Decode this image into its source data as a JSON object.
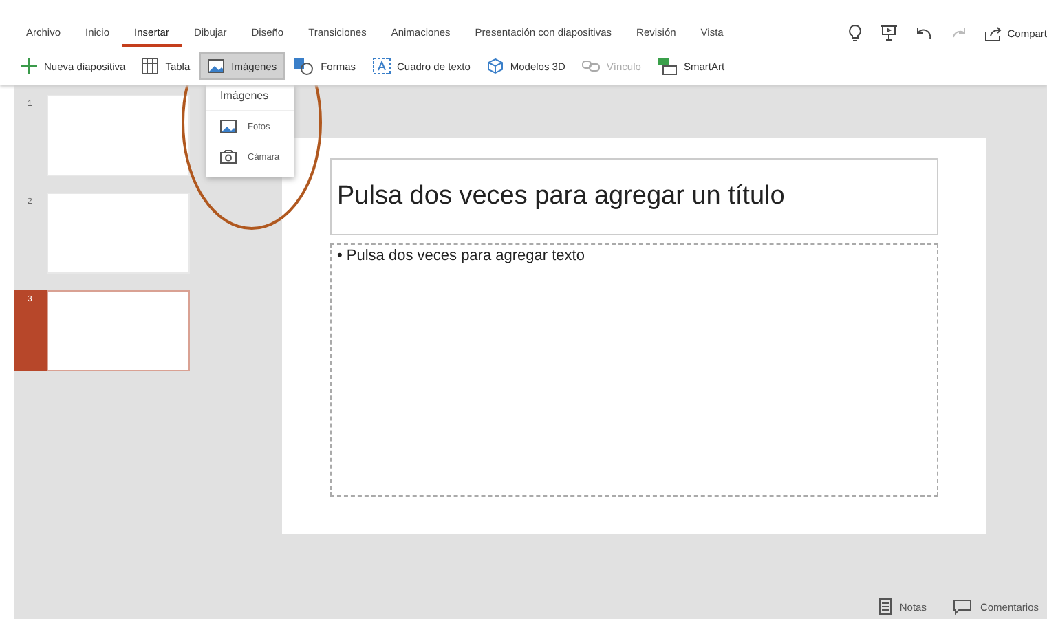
{
  "tabs": [
    {
      "label": "Archivo",
      "selected": false
    },
    {
      "label": "Inicio",
      "selected": false
    },
    {
      "label": "Insertar",
      "selected": true
    },
    {
      "label": "Dibujar",
      "selected": false
    },
    {
      "label": "Diseño",
      "selected": false
    },
    {
      "label": "Transiciones",
      "selected": false
    },
    {
      "label": "Animaciones",
      "selected": false
    },
    {
      "label": "Presentación con diapositivas",
      "selected": false
    },
    {
      "label": "Revisión",
      "selected": false
    },
    {
      "label": "Vista",
      "selected": false
    }
  ],
  "share_button": {
    "label": "Compart"
  },
  "toolbar": [
    {
      "kind": "plus",
      "label": "Nueva diapositiva",
      "selected": false,
      "disabled": false
    },
    {
      "kind": "table",
      "label": "Tabla",
      "selected": false,
      "disabled": false
    },
    {
      "kind": "image",
      "label": "Imágenes",
      "selected": true,
      "disabled": false
    },
    {
      "kind": "shapes",
      "label": "Formas",
      "selected": false,
      "disabled": false
    },
    {
      "kind": "textbox",
      "label": "Cuadro de texto",
      "selected": false,
      "disabled": false
    },
    {
      "kind": "cube",
      "label": "Modelos 3D",
      "selected": false,
      "disabled": false
    },
    {
      "kind": "link",
      "label": "Vínculo",
      "selected": false,
      "disabled": true
    },
    {
      "kind": "smartart",
      "label": "SmartArt",
      "selected": false,
      "disabled": false
    }
  ],
  "dropdown": {
    "header": "Imágenes",
    "items": [
      {
        "kind": "image",
        "label": "Fotos"
      },
      {
        "kind": "camera",
        "label": "Cámara"
      }
    ]
  },
  "slides": [
    {
      "number": "1",
      "selected": false
    },
    {
      "number": "2",
      "selected": false
    },
    {
      "number": "3",
      "selected": true
    }
  ],
  "slide": {
    "title_placeholder": "Pulsa dos veces para agregar un título",
    "body_placeholder": "• Pulsa dos veces para agregar texto"
  },
  "status_bar": [
    {
      "kind": "notes",
      "label": "Notas"
    },
    {
      "kind": "comments",
      "label": "Comentarios"
    }
  ],
  "annotation": {
    "kind": "ellipse"
  }
}
